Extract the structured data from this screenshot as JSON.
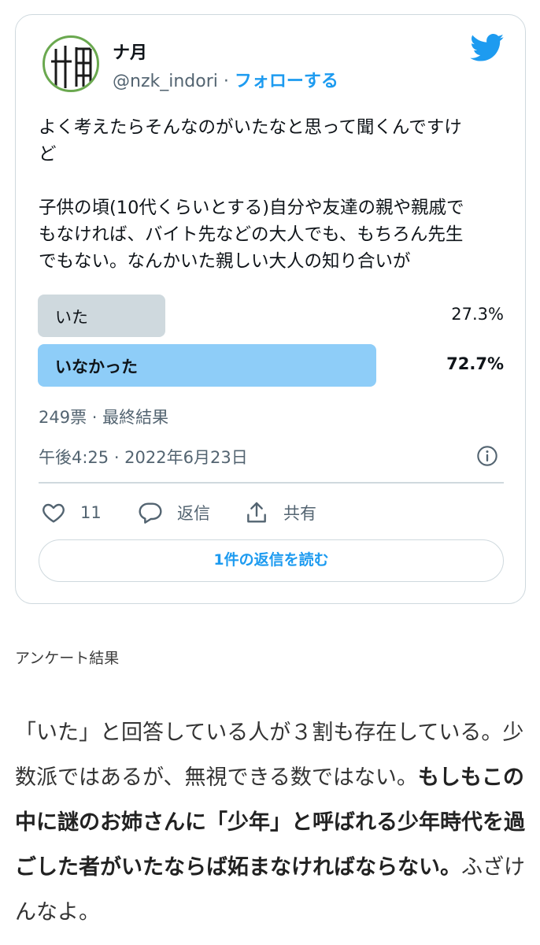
{
  "tweet": {
    "display_name": "ナ月",
    "handle": "@nzk_indori",
    "separator": " · ",
    "follow_label": "フォローする",
    "text_lines": [
      "よく考えたらそんなのがいたなと思って聞くんですけ",
      "ど",
      "",
      "子供の頃(10代くらいとする)自分や友達の親や親戚で",
      "もなければ、バイト先などの大人でも、もちろん先生",
      "でもない。なんかいた親しい大人の知り合いが"
    ],
    "poll": {
      "options": [
        {
          "label": "いた",
          "percent_text": "27.3%",
          "percent": 27.3,
          "winner": false
        },
        {
          "label": "いなかった",
          "percent_text": "72.7%",
          "percent": 72.7,
          "winner": true
        }
      ],
      "summary": "249票 · 最終結果"
    },
    "timestamp": "午後4:25 · 2022年6月23日",
    "actions": {
      "like_count": "11",
      "reply_label": "返信",
      "share_label": "共有"
    },
    "read_replies_label": "1件の返信を読む"
  },
  "caption": "アンケート結果",
  "article": {
    "part1": "「いた」と回答している人が３割も存在している。少数派ではあるが、無視できる数ではない。",
    "bold": "もしもこの中に謎のお姉さんに「少年」と呼ばれる少年時代を過ごした者がいたならば妬まなければならない。",
    "part2": "ふざけんなよ。"
  },
  "colors": {
    "accent": "#1d9bf0",
    "winner_bar": "#8ecdf8",
    "loser_bar": "#cfd9de",
    "avatar_ring": "#6aa84f"
  }
}
